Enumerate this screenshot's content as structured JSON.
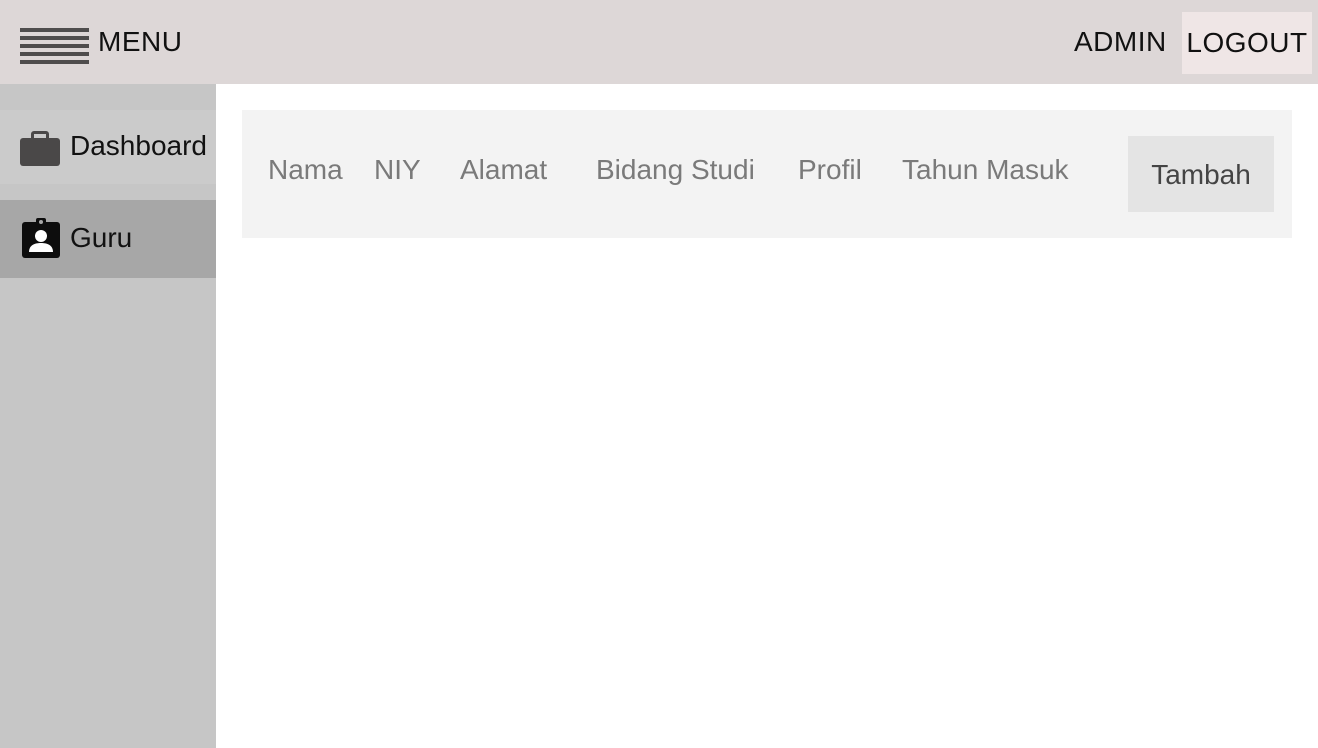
{
  "topbar": {
    "menu_label": "MENU",
    "menu_icon": "hamburger-icon",
    "user_label": "ADMIN",
    "logout_label": "LOGOUT"
  },
  "sidebar": {
    "items": [
      {
        "label": "Dashboard",
        "icon": "briefcase-icon",
        "active": false
      },
      {
        "label": "Guru",
        "icon": "badge-person-icon",
        "active": true
      }
    ]
  },
  "table": {
    "columns": [
      "Nama",
      "NIY",
      "Alamat",
      "Bidang Studi",
      "Profil",
      "Tahun Masuk"
    ],
    "add_label": "Tambah"
  },
  "colors": {
    "topbar_bg": "#ddd7d7",
    "sidebar_bg": "#c6c6c6",
    "active_item_bg": "#a7a7a7",
    "table_header_bg": "#f3f3f3"
  }
}
